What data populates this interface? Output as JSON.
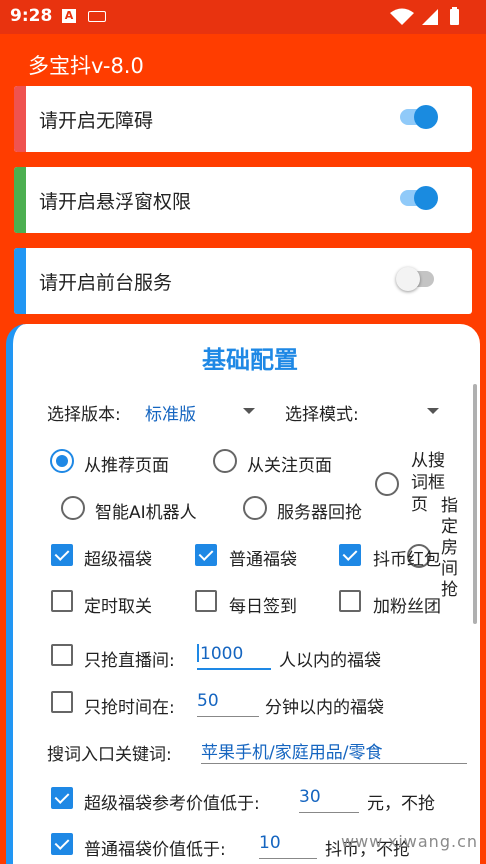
{
  "status_bar": {
    "time": "9:28",
    "notif_icon_letter": "A"
  },
  "app": {
    "title": "多宝抖v-8.0"
  },
  "permissions": [
    {
      "label": "请开启无障碍",
      "enabled": true,
      "bar_color": "#ef5350"
    },
    {
      "label": "请开启悬浮窗权限",
      "enabled": true,
      "bar_color": "#4caf50"
    },
    {
      "label": "请开启前台服务",
      "enabled": false,
      "bar_color": "#2196f3"
    }
  ],
  "config": {
    "title": "基础配置",
    "version_label": "选择版本:",
    "version_value": "标准版",
    "mode_label": "选择模式:",
    "mode_value": "",
    "sources": [
      {
        "label": "从推荐页面",
        "checked": true
      },
      {
        "label": "从关注页面",
        "checked": false
      },
      {
        "label": "从搜词框页",
        "checked": false
      },
      {
        "label": "智能AI机器人",
        "checked": false
      },
      {
        "label": "服务器回抢",
        "checked": false
      },
      {
        "label": "指定房间抢",
        "checked": false
      }
    ],
    "bag_types": [
      {
        "label": "超级福袋",
        "checked": true
      },
      {
        "label": "普通福袋",
        "checked": true
      },
      {
        "label": "抖币红包",
        "checked": true
      }
    ],
    "extras": [
      {
        "label": "定时取关",
        "checked": false
      },
      {
        "label": "每日签到",
        "checked": false
      },
      {
        "label": "加粉丝团",
        "checked": false
      }
    ],
    "live_limit": {
      "prefix": "只抢直播间:",
      "value": "1000",
      "suffix": "人以内的福袋",
      "checked": false
    },
    "time_limit": {
      "prefix": "只抢时间在:",
      "value": "50",
      "suffix": "分钟以内的福袋",
      "checked": false
    },
    "keywords": {
      "label": "搜词入口关键词:",
      "value": "苹果手机/家庭用品/零食"
    },
    "super_value": {
      "prefix": "超级福袋参考价值低于:",
      "value": "30",
      "suffix": "元，不抢",
      "checked": true
    },
    "normal_value": {
      "prefix": "普通福袋价值低于:",
      "value": "10",
      "suffix": "抖币，不抢",
      "checked": true
    }
  },
  "watermark": "www.xiwang.cn",
  "colors": {
    "primary": "#1e88e5",
    "header": "#ff3d00"
  }
}
